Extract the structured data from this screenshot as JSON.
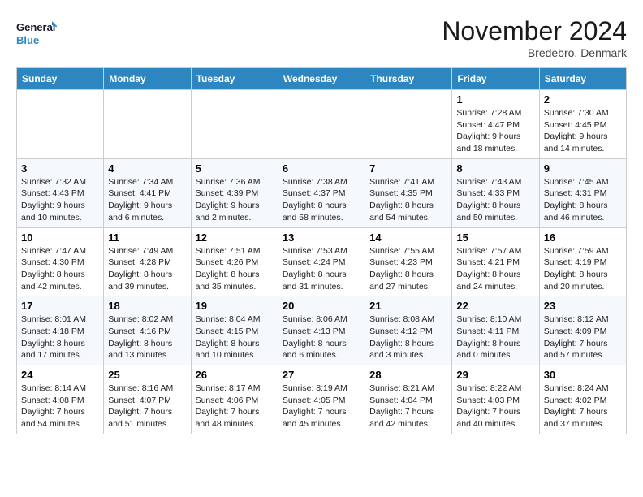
{
  "header": {
    "logo_line1": "General",
    "logo_line2": "Blue",
    "month_title": "November 2024",
    "location": "Bredebro, Denmark"
  },
  "weekdays": [
    "Sunday",
    "Monday",
    "Tuesday",
    "Wednesday",
    "Thursday",
    "Friday",
    "Saturday"
  ],
  "weeks": [
    [
      {
        "day": "",
        "info": ""
      },
      {
        "day": "",
        "info": ""
      },
      {
        "day": "",
        "info": ""
      },
      {
        "day": "",
        "info": ""
      },
      {
        "day": "",
        "info": ""
      },
      {
        "day": "1",
        "info": "Sunrise: 7:28 AM\nSunset: 4:47 PM\nDaylight: 9 hours\nand 18 minutes."
      },
      {
        "day": "2",
        "info": "Sunrise: 7:30 AM\nSunset: 4:45 PM\nDaylight: 9 hours\nand 14 minutes."
      }
    ],
    [
      {
        "day": "3",
        "info": "Sunrise: 7:32 AM\nSunset: 4:43 PM\nDaylight: 9 hours\nand 10 minutes."
      },
      {
        "day": "4",
        "info": "Sunrise: 7:34 AM\nSunset: 4:41 PM\nDaylight: 9 hours\nand 6 minutes."
      },
      {
        "day": "5",
        "info": "Sunrise: 7:36 AM\nSunset: 4:39 PM\nDaylight: 9 hours\nand 2 minutes."
      },
      {
        "day": "6",
        "info": "Sunrise: 7:38 AM\nSunset: 4:37 PM\nDaylight: 8 hours\nand 58 minutes."
      },
      {
        "day": "7",
        "info": "Sunrise: 7:41 AM\nSunset: 4:35 PM\nDaylight: 8 hours\nand 54 minutes."
      },
      {
        "day": "8",
        "info": "Sunrise: 7:43 AM\nSunset: 4:33 PM\nDaylight: 8 hours\nand 50 minutes."
      },
      {
        "day": "9",
        "info": "Sunrise: 7:45 AM\nSunset: 4:31 PM\nDaylight: 8 hours\nand 46 minutes."
      }
    ],
    [
      {
        "day": "10",
        "info": "Sunrise: 7:47 AM\nSunset: 4:30 PM\nDaylight: 8 hours\nand 42 minutes."
      },
      {
        "day": "11",
        "info": "Sunrise: 7:49 AM\nSunset: 4:28 PM\nDaylight: 8 hours\nand 39 minutes."
      },
      {
        "day": "12",
        "info": "Sunrise: 7:51 AM\nSunset: 4:26 PM\nDaylight: 8 hours\nand 35 minutes."
      },
      {
        "day": "13",
        "info": "Sunrise: 7:53 AM\nSunset: 4:24 PM\nDaylight: 8 hours\nand 31 minutes."
      },
      {
        "day": "14",
        "info": "Sunrise: 7:55 AM\nSunset: 4:23 PM\nDaylight: 8 hours\nand 27 minutes."
      },
      {
        "day": "15",
        "info": "Sunrise: 7:57 AM\nSunset: 4:21 PM\nDaylight: 8 hours\nand 24 minutes."
      },
      {
        "day": "16",
        "info": "Sunrise: 7:59 AM\nSunset: 4:19 PM\nDaylight: 8 hours\nand 20 minutes."
      }
    ],
    [
      {
        "day": "17",
        "info": "Sunrise: 8:01 AM\nSunset: 4:18 PM\nDaylight: 8 hours\nand 17 minutes."
      },
      {
        "day": "18",
        "info": "Sunrise: 8:02 AM\nSunset: 4:16 PM\nDaylight: 8 hours\nand 13 minutes."
      },
      {
        "day": "19",
        "info": "Sunrise: 8:04 AM\nSunset: 4:15 PM\nDaylight: 8 hours\nand 10 minutes."
      },
      {
        "day": "20",
        "info": "Sunrise: 8:06 AM\nSunset: 4:13 PM\nDaylight: 8 hours\nand 6 minutes."
      },
      {
        "day": "21",
        "info": "Sunrise: 8:08 AM\nSunset: 4:12 PM\nDaylight: 8 hours\nand 3 minutes."
      },
      {
        "day": "22",
        "info": "Sunrise: 8:10 AM\nSunset: 4:11 PM\nDaylight: 8 hours\nand 0 minutes."
      },
      {
        "day": "23",
        "info": "Sunrise: 8:12 AM\nSunset: 4:09 PM\nDaylight: 7 hours\nand 57 minutes."
      }
    ],
    [
      {
        "day": "24",
        "info": "Sunrise: 8:14 AM\nSunset: 4:08 PM\nDaylight: 7 hours\nand 54 minutes."
      },
      {
        "day": "25",
        "info": "Sunrise: 8:16 AM\nSunset: 4:07 PM\nDaylight: 7 hours\nand 51 minutes."
      },
      {
        "day": "26",
        "info": "Sunrise: 8:17 AM\nSunset: 4:06 PM\nDaylight: 7 hours\nand 48 minutes."
      },
      {
        "day": "27",
        "info": "Sunrise: 8:19 AM\nSunset: 4:05 PM\nDaylight: 7 hours\nand 45 minutes."
      },
      {
        "day": "28",
        "info": "Sunrise: 8:21 AM\nSunset: 4:04 PM\nDaylight: 7 hours\nand 42 minutes."
      },
      {
        "day": "29",
        "info": "Sunrise: 8:22 AM\nSunset: 4:03 PM\nDaylight: 7 hours\nand 40 minutes."
      },
      {
        "day": "30",
        "info": "Sunrise: 8:24 AM\nSunset: 4:02 PM\nDaylight: 7 hours\nand 37 minutes."
      }
    ]
  ]
}
